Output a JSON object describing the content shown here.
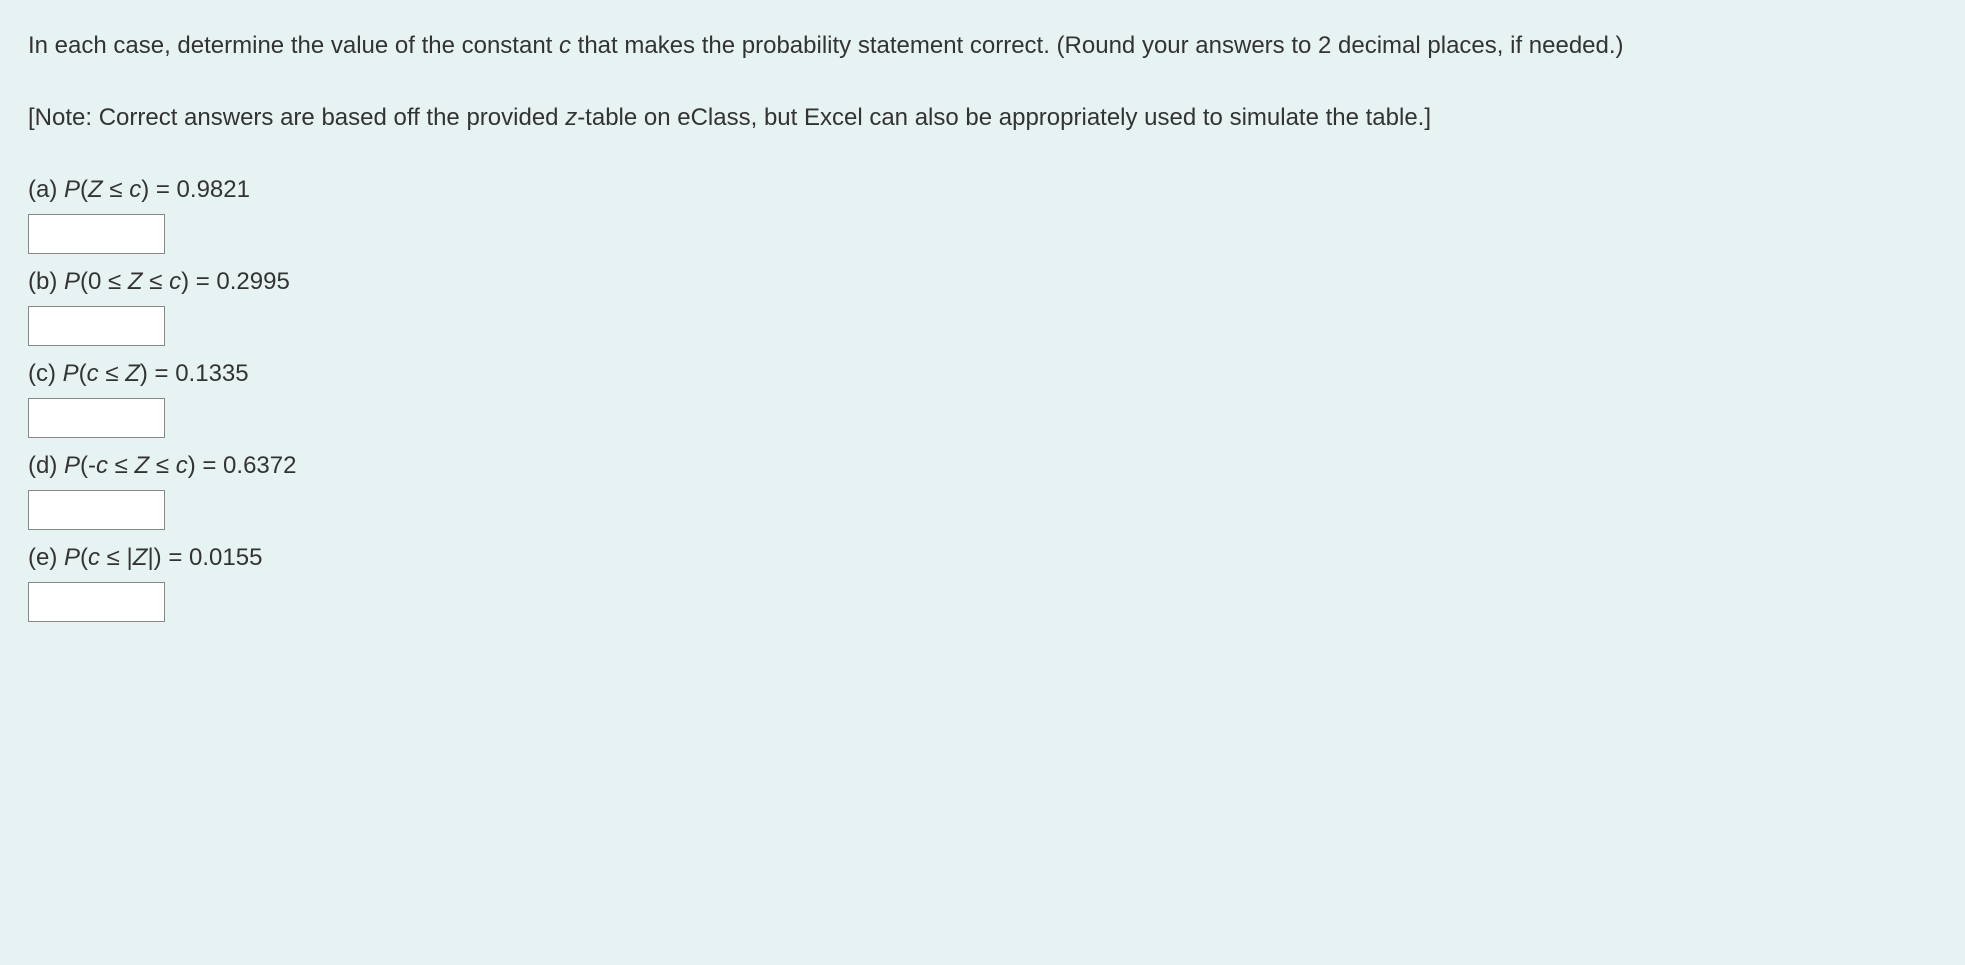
{
  "intro": {
    "p1_before": "In each case, determine the value of the constant ",
    "p1_var": "c",
    "p1_after": " that makes the probability statement correct. (Round your answers to 2 decimal places, if needed.)",
    "p2_before": "[Note: Correct answers are based off the provided ",
    "p2_var": "z",
    "p2_after": "-table on eClass, but Excel can also be appropriately used to simulate the table.]"
  },
  "questions": {
    "a": {
      "letter": "(a) ",
      "p": "P",
      "open": "(",
      "z": "Z",
      "mid1": " ≤ ",
      "c": "c",
      "close": ")",
      "eq": " = 0.9821"
    },
    "b": {
      "letter": "(b) ",
      "p": "P",
      "open": "(0 ≤ ",
      "z": "Z",
      "mid1": " ≤ ",
      "c": "c",
      "close": ")",
      "eq": " = 0.2995"
    },
    "c": {
      "letter": "(c) ",
      "p": "P",
      "open": "(",
      "c": "c",
      "mid1": " ≤ ",
      "z": "Z",
      "close": ")",
      "eq": " = 0.1335"
    },
    "d": {
      "letter": "(d) ",
      "p": "P",
      "open": "(-",
      "c1": "c",
      "mid1": " ≤ ",
      "z": "Z",
      "mid2": " ≤ ",
      "c2": "c",
      "close": ")",
      "eq": " = 0.6372"
    },
    "e": {
      "letter": "(e) ",
      "p": "P",
      "open": "(",
      "c": "c",
      "mid1": " ≤ |",
      "z": "Z",
      "close": "|)",
      "eq": " = 0.0155"
    }
  }
}
